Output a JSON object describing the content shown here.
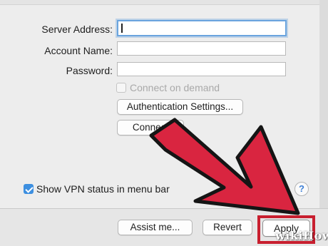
{
  "form": {
    "server_address_label": "Server Address:",
    "account_name_label": "Account Name:",
    "password_label": "Password:",
    "server_address_value": "",
    "account_name_value": "",
    "password_value": "",
    "connect_on_demand_label": "Connect on demand",
    "authentication_button": "Authentication Settings...",
    "connect_button": "Connect",
    "show_vpn_status_label": "Show VPN status in menu bar",
    "show_vpn_status_checked": true,
    "help_glyph": "?"
  },
  "footer": {
    "assist_button": "Assist me...",
    "revert_button": "Revert",
    "apply_button": "Apply"
  },
  "overlay": {
    "arrow_color": "#d92540",
    "highlight_color": "#c81f2f",
    "watermark": "wikiHow"
  }
}
